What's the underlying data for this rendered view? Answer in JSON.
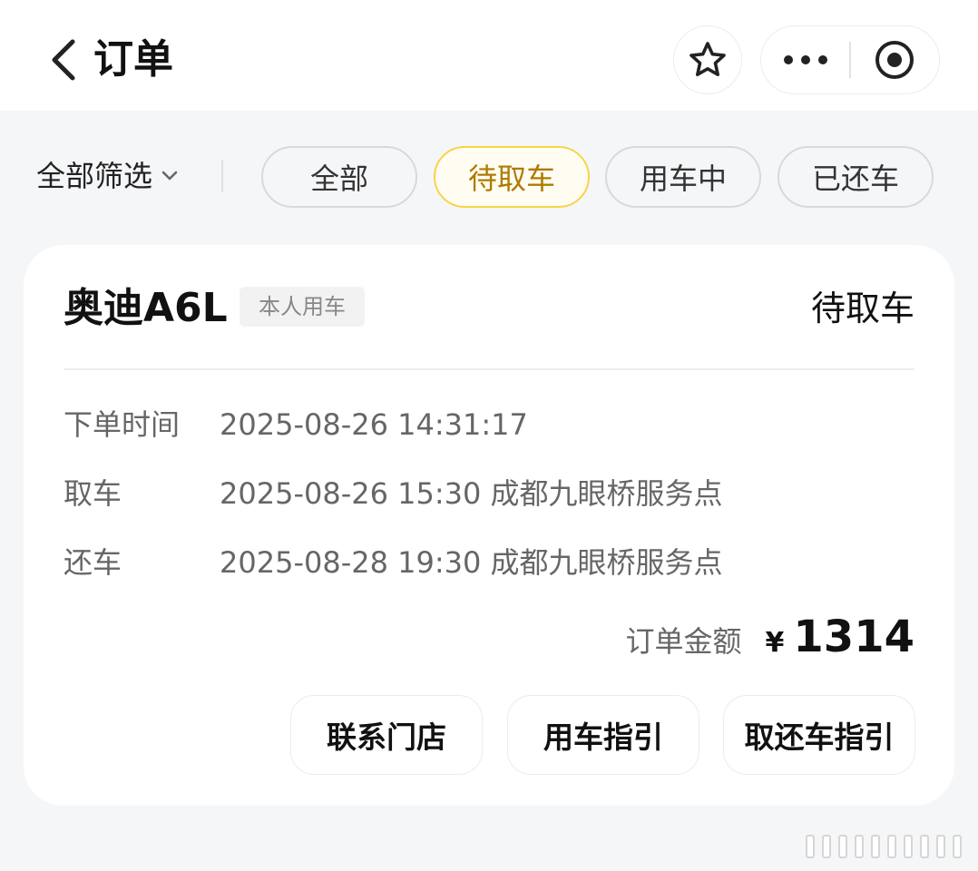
{
  "header": {
    "title": "订单",
    "back_icon": "chevron-left-icon",
    "star_icon": "star-icon",
    "more_icon": "more-dots-icon",
    "close_icon": "record-circle-icon"
  },
  "filter": {
    "all_filter_label": "全部筛选",
    "tabs": [
      {
        "label": "全部",
        "active": false
      },
      {
        "label": "待取车",
        "active": true
      },
      {
        "label": "用车中",
        "active": false
      },
      {
        "label": "已还车",
        "active": false
      }
    ]
  },
  "order": {
    "car_name": "奥迪A6L",
    "usage_tag": "本人用车",
    "status": "待取车",
    "details": [
      {
        "label": "下单时间",
        "value": "2025-08-26 14:31:17"
      },
      {
        "label": "取车",
        "value": "2025-08-26 15:30 成都九眼桥服务点"
      },
      {
        "label": "还车",
        "value": "2025-08-28 19:30 成都九眼桥服务点"
      }
    ],
    "amount_label": "订单金额",
    "currency": "¥",
    "amount": "1314",
    "actions": [
      {
        "label": "联系门店"
      },
      {
        "label": "用车指引"
      },
      {
        "label": "取还车指引"
      }
    ]
  },
  "colors": {
    "active_tab_border": "#f5d547",
    "active_tab_text": "#b07a00",
    "page_background": "#f5f6f8"
  }
}
